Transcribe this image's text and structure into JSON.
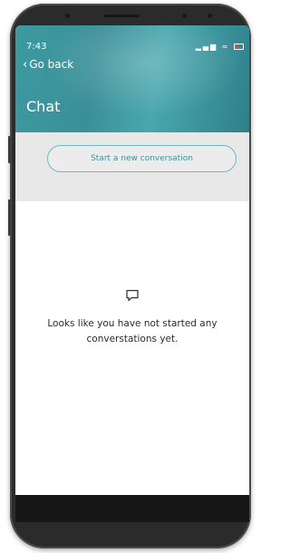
{
  "status_bar": {
    "time": "7:43"
  },
  "nav": {
    "back_label": "Go back"
  },
  "header": {
    "title": "Chat"
  },
  "actions": {
    "new_conversation": "Start a new conversation"
  },
  "empty_state": {
    "message": "Looks like you have not started any converstations yet."
  },
  "theme": {
    "header_teal": "#3b8f98",
    "accent_outline": "#6fb9be",
    "band_gray": "#e8e8e8"
  },
  "icons": {
    "back": "chevron-left-icon",
    "empty": "chat-bubble-icon"
  }
}
